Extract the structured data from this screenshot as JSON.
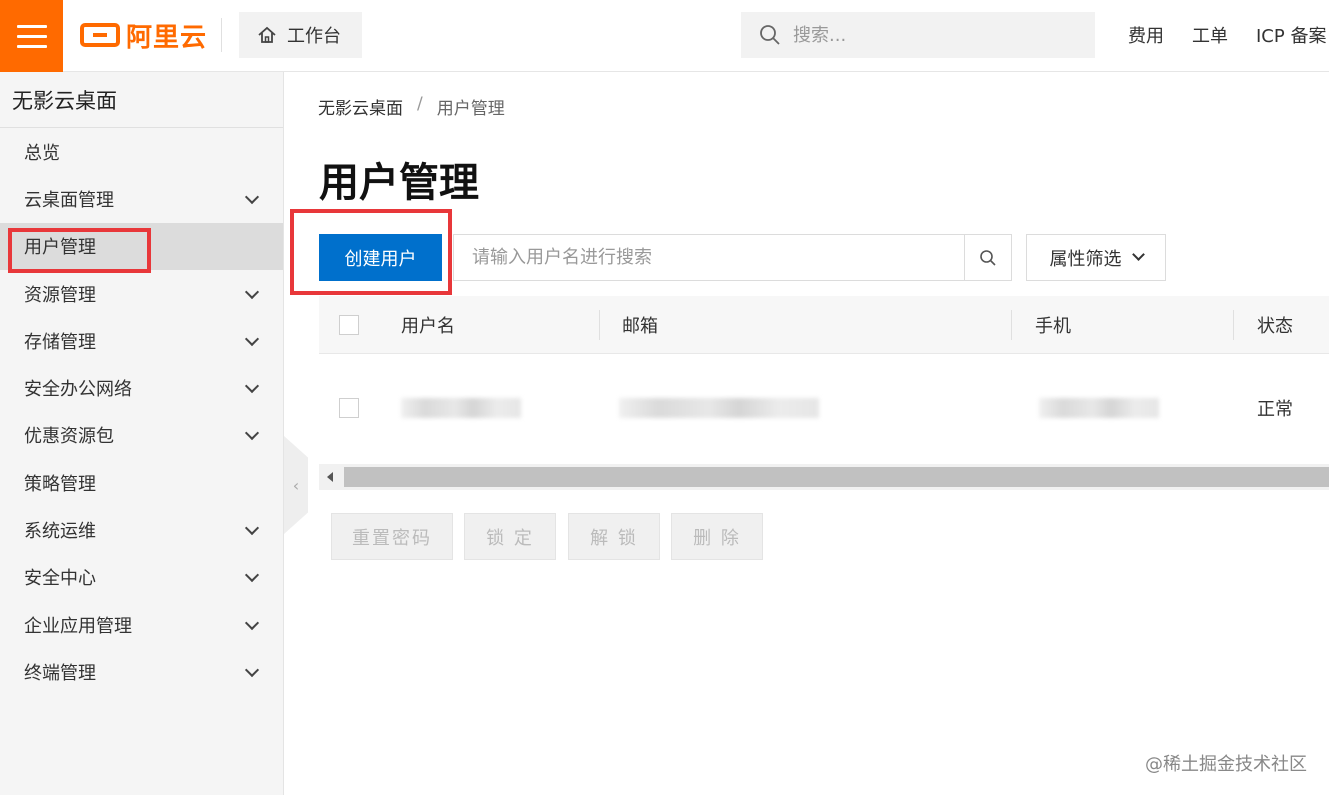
{
  "topbar": {
    "brand": "阿里云",
    "workbench_label": "工作台",
    "search_placeholder": "搜索...",
    "links": [
      "费用",
      "工单",
      "ICP 备案"
    ]
  },
  "sidebar": {
    "title": "无影云桌面",
    "items": [
      {
        "label": "总览",
        "expandable": false
      },
      {
        "label": "云桌面管理",
        "expandable": true
      },
      {
        "label": "用户管理",
        "expandable": false,
        "active": true
      },
      {
        "label": "资源管理",
        "expandable": true
      },
      {
        "label": "存储管理",
        "expandable": true
      },
      {
        "label": "安全办公网络",
        "expandable": true
      },
      {
        "label": "优惠资源包",
        "expandable": true
      },
      {
        "label": "策略管理",
        "expandable": false
      },
      {
        "label": "系统运维",
        "expandable": true
      },
      {
        "label": "安全中心",
        "expandable": true
      },
      {
        "label": "企业应用管理",
        "expandable": true
      },
      {
        "label": "终端管理",
        "expandable": true
      }
    ]
  },
  "breadcrumb": {
    "root": "无影云桌面",
    "separator": "/",
    "current": "用户管理"
  },
  "page_title": "用户管理",
  "toolbar": {
    "create_label": "创建用户",
    "search_placeholder": "请输入用户名进行搜索",
    "filter_label": "属性筛选"
  },
  "table": {
    "columns": [
      "用户名",
      "邮箱",
      "手机",
      "状态"
    ],
    "rows": [
      {
        "status": "正常"
      }
    ]
  },
  "actions": [
    "重置密码",
    "锁 定",
    "解 锁",
    "删 除"
  ],
  "watermark": "@稀土掘金技术社区",
  "colors": {
    "brand_orange": "#ff6a00",
    "primary_blue": "#0070cc",
    "highlight_red": "#e8373a"
  }
}
